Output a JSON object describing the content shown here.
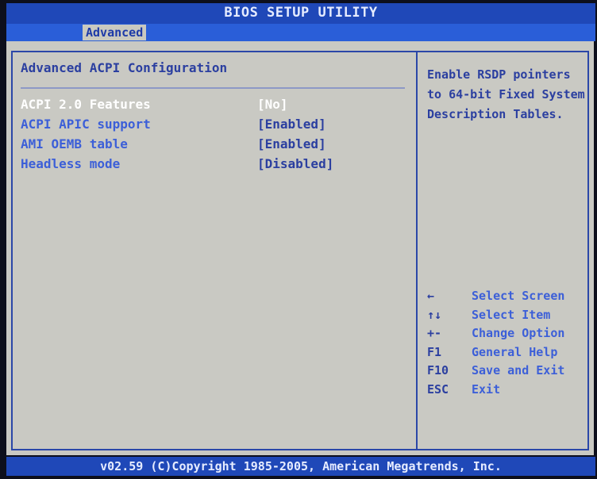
{
  "window": {
    "title": "BIOS SETUP UTILITY"
  },
  "tabs": [
    {
      "label": "Advanced",
      "active": true
    }
  ],
  "main": {
    "page_title": "Advanced ACPI Configuration",
    "settings": [
      {
        "label": "ACPI 2.0 Features",
        "value": "[No]",
        "selected": true
      },
      {
        "label": "ACPI APIC support",
        "value": "[Enabled]",
        "selected": false
      },
      {
        "label": "AMI OEMB table",
        "value": "[Enabled]",
        "selected": false
      },
      {
        "label": "Headless mode",
        "value": "[Disabled]",
        "selected": false
      }
    ]
  },
  "help": {
    "text": "Enable RSDP pointers\nto 64-bit Fixed System\nDescription Tables."
  },
  "keys": [
    {
      "key": "←",
      "desc": "Select Screen",
      "icon": "arrow-left-icon"
    },
    {
      "key": "↑↓",
      "desc": "Select Item",
      "icon": "arrow-up-down-icon"
    },
    {
      "key": "+-",
      "desc": "Change Option",
      "icon": "plus-minus-icon"
    },
    {
      "key": "F1",
      "desc": "General Help"
    },
    {
      "key": "F10",
      "desc": "Save and Exit"
    },
    {
      "key": "ESC",
      "desc": "Exit"
    }
  ],
  "status": {
    "text": "v02.59 (C)Copyright 1985-2005, American Megatrends, Inc."
  },
  "colors": {
    "bar_blue": "#1f48b8",
    "panel_gray": "#c9c9c3",
    "text_blue": "#2b3fa0",
    "label_blue": "#3c5fd8",
    "selected_white": "#ffffff"
  }
}
